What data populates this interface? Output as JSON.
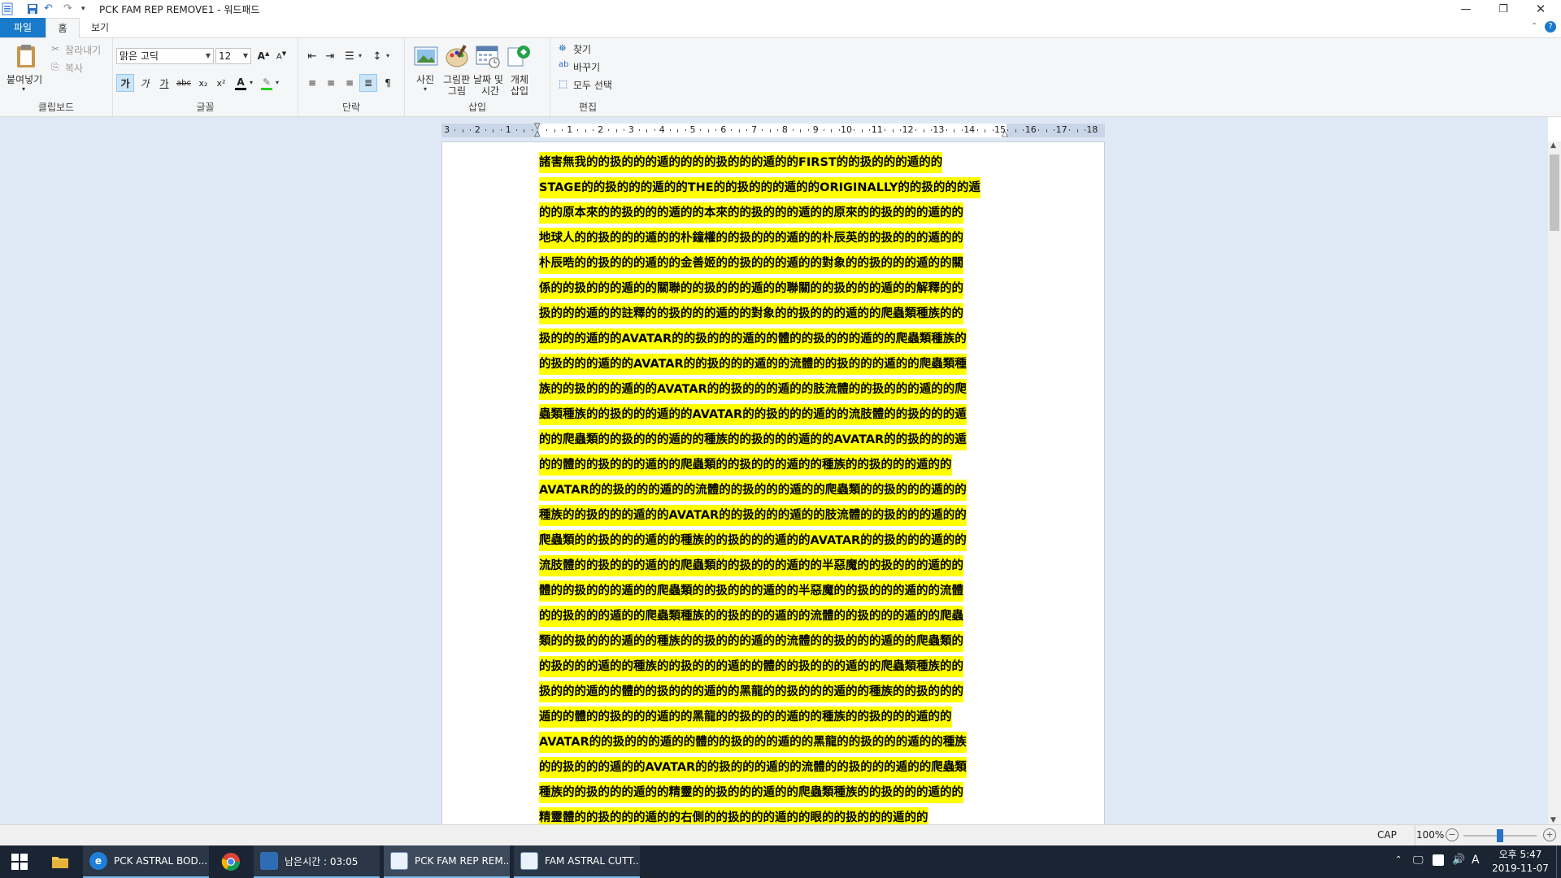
{
  "window": {
    "title": "PCK FAM REP REMOVE1 - 워드패드",
    "minimize_icon": "minimize-icon",
    "maximize_icon": "restore-icon",
    "close_icon": "close-icon"
  },
  "ribbon_tabs": [
    {
      "label": "파일"
    },
    {
      "label": "홈"
    },
    {
      "label": "보기"
    }
  ],
  "clipboard": {
    "paste": "붙여넣기",
    "cut": "잘라내기",
    "copy": "복사",
    "group": "클립보드"
  },
  "font": {
    "family": "맑은 고딕",
    "size": "12",
    "bold": "가",
    "italic": "가",
    "underline": "가",
    "strike": "abc",
    "subscript": "x₂",
    "superscript": "x²",
    "color_label": "A",
    "group": "글꼴",
    "font_color": "#000000",
    "highlight_color": "#2ad12a"
  },
  "paragraph": {
    "group": "단락"
  },
  "insert": {
    "picture": "사진",
    "paint1": "그림판",
    "paint2": "그림",
    "date1": "날짜 및",
    "date2": "시간",
    "object1": "개체",
    "object2": "삽입",
    "group": "삽입"
  },
  "editing": {
    "find": "찾기",
    "replace": "바꾸기",
    "select_all": "모두 선택",
    "group": "편집"
  },
  "ruler": {
    "labels": [
      "3",
      "2",
      "1",
      "",
      "1",
      "2",
      "3",
      "4",
      "5",
      "6",
      "7",
      "8",
      "9",
      "10",
      "11",
      "12",
      "13",
      "14",
      "15",
      "16",
      "17",
      "18"
    ]
  },
  "document": {
    "highlight_color": "#ffff00",
    "lines": [
      "諸害無我的的扱的的的遁的的的的扱的的的遁的的FIRST的的扱的的的遁的的",
      "STAGE的的扱的的的遁的的THE的的扱的的的遁的的ORIGINALLY的的扱的的的遁",
      "的的原本來的的扱的的的遁的的本來的的扱的的的遁的的原來的的扱的的的遁的的",
      "地球人的的扱的的的遁的的朴鐘權的的扱的的的遁的的朴辰英的的扱的的的遁的的",
      "朴辰晧的的扱的的的遁的的金善姬的的扱的的的遁的的對象的的扱的的的遁的的關",
      "係的的扱的的的遁的的關聯的的扱的的的遁的的聯關的的扱的的的遁的的解釋的的",
      "扱的的的遁的的註釋的的扱的的的遁的的對象的的扱的的的遁的的爬蟲類種族的的",
      "扱的的的遁的的AVATAR的的扱的的的遁的的體的的扱的的的遁的的爬蟲類種族的",
      "的扱的的的遁的的AVATAR的的扱的的的遁的的流體的的扱的的的遁的的爬蟲類種",
      "族的的扱的的的遁的的AVATAR的的扱的的的遁的的肢流體的的扱的的的遁的的爬",
      "蟲類種族的的扱的的的遁的的AVATAR的的扱的的的遁的的流肢體的的扱的的的遁",
      "的的爬蟲類的的扱的的的遁的的種族的的扱的的的遁的的AVATAR的的扱的的的遁",
      "的的體的的扱的的的遁的的爬蟲類的的扱的的的遁的的種族的的扱的的的遁的的",
      "AVATAR的的扱的的的遁的的流體的的扱的的的遁的的爬蟲類的的扱的的的遁的的",
      "種族的的扱的的的遁的的AVATAR的的扱的的的遁的的肢流體的的扱的的的遁的的",
      "爬蟲類的的扱的的的遁的的種族的的扱的的的遁的的AVATAR的的扱的的的遁的的",
      "流肢體的的扱的的的遁的的爬蟲類的的扱的的的遁的的半惡魔的的扱的的的遁的的",
      "體的的扱的的的遁的的爬蟲類的的扱的的的遁的的半惡魔的的扱的的的遁的的流體",
      "的的扱的的的遁的的爬蟲類種族的的扱的的的遁的的流體的的扱的的的遁的的爬蟲",
      "類的的扱的的的遁的的種族的的扱的的的遁的的流體的的扱的的的遁的的爬蟲類的",
      "的扱的的的遁的的種族的的扱的的的遁的的體的的扱的的的遁的的爬蟲類種族的的",
      "扱的的的遁的的體的的扱的的的遁的的黑龍的的扱的的的遁的的種族的的扱的的的",
      "遁的的體的的扱的的的遁的的黑龍的的扱的的的遁的的種族的的扱的的的遁的的",
      "AVATAR的的扱的的的遁的的體的的扱的的的遁的的黑龍的的扱的的的遁的的種族",
      "的的扱的的的遁的的AVATAR的的扱的的的遁的的流體的的扱的的的遁的的爬蟲類",
      "種族的的扱的的的遁的的精靈的的扱的的的遁的的爬蟲類種族的的扱的的的遁的的",
      "精靈體的的扱的的的遁的的右側的的扱的的的遁的的眼的的扱的的的遁的的"
    ]
  },
  "statusbar": {
    "caps": "CAP",
    "zoom": "100%",
    "zoom_level": 1.0
  },
  "taskbar": {
    "apps": [
      {
        "label": "PCK ASTRAL BOD...",
        "icon": "ie-icon"
      },
      {
        "label": "",
        "icon": "chrome-icon"
      },
      {
        "label": "남은시간 : 03:05",
        "icon": "timer-app-icon"
      },
      {
        "label": "PCK FAM REP REM...",
        "icon": "wordpad-icon"
      },
      {
        "label": "FAM ASTRAL CUTT...",
        "icon": "wordpad-icon"
      }
    ],
    "ime": "A",
    "time": "오후 5:47",
    "date": "2019-11-07"
  }
}
